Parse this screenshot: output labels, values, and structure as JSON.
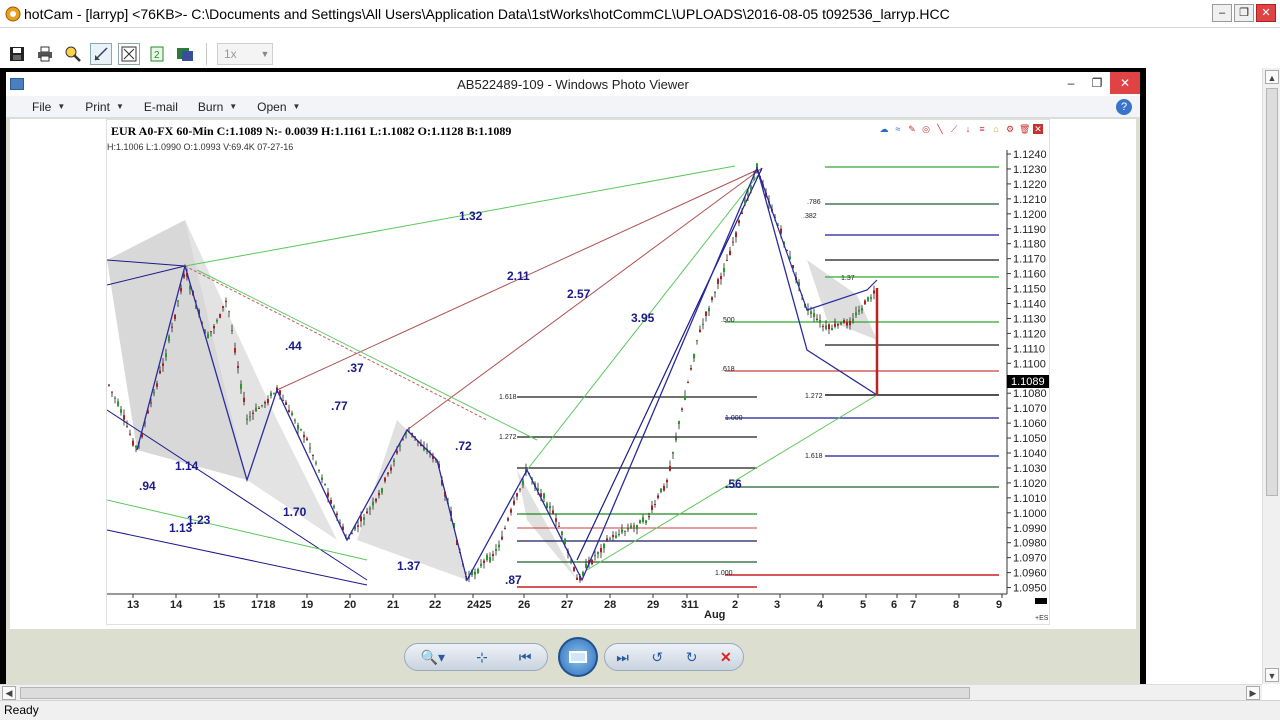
{
  "app": {
    "title": "hotCam - [larryp] <76KB>- C:\\Documents and Settings\\All Users\\Application Data\\1stWorks\\hotCommCL\\UPLOADS\\2016-08-05 t092536_larryp.HCC",
    "zoom_value": "1x"
  },
  "toolbar": {
    "icons": [
      "save-icon",
      "print-icon",
      "search-tools-icon",
      "draw-icon",
      "fit-icon",
      "refresh-icon",
      "export-icon"
    ]
  },
  "viewer": {
    "title": "AB522489-109 - Windows Photo Viewer",
    "menu": [
      {
        "label": "File",
        "caret": true
      },
      {
        "label": "Print",
        "caret": true
      },
      {
        "label": "E-mail",
        "caret": false
      },
      {
        "label": "Burn",
        "caret": true
      },
      {
        "label": "Open",
        "caret": true
      }
    ]
  },
  "chart": {
    "header": "EUR A0-FX 60-Min C:1.1089 N:- 0.0039 H:1.1161 L:1.1082 O:1.1128 B:1.1089",
    "subheader": "H:1.1006  L:1.0990  O:1.0993  V:69.4K  07-27-16",
    "current_price": "1.1089",
    "month_label": "Aug",
    "corner_label": "+ES"
  },
  "chart_data": {
    "type": "line",
    "y_ticks": [
      "1.1240",
      "1.1230",
      "1.1220",
      "1.1210",
      "1.1200",
      "1.1190",
      "1.1180",
      "1.1170",
      "1.1160",
      "1.1150",
      "1.1140",
      "1.1130",
      "1.1120",
      "1.1110",
      "1.1100",
      "1.1089",
      "1.1080",
      "1.1070",
      "1.1060",
      "1.1050",
      "1.1040",
      "1.1030",
      "1.1020",
      "1.1010",
      "1.1000",
      "1.0990",
      "1.0980",
      "1.0970",
      "1.0960",
      "1.0950"
    ],
    "x_ticks": [
      "13",
      "14",
      "15",
      "1718",
      "19",
      "20",
      "21",
      "22",
      "2425",
      "26",
      "27",
      "28",
      "29",
      "311",
      "2",
      "3",
      "4",
      "5",
      "6",
      "7",
      "8",
      "9"
    ],
    "ratio_labels": [
      "1.32",
      "2.11",
      "2.57",
      "3.95",
      ".44",
      ".37",
      ".77",
      ".72",
      "1.14",
      "1.70",
      "1.23",
      "1.13",
      "1.37",
      ".94",
      ".87",
      ".56"
    ],
    "small_labels": [
      "1.618",
      "1.272",
      "1.000",
      "1.37",
      "1.618",
      "1.272",
      "1.000",
      ".618",
      ".786",
      ".382",
      ".500"
    ],
    "ylim": [
      1.0945,
      1.1245
    ]
  },
  "controls": {
    "buttons": [
      "zoom-icon",
      "actual-size-icon",
      "previous-icon",
      "slideshow-icon",
      "next-icon",
      "rotate-left-icon",
      "rotate-right-icon",
      "delete-icon"
    ]
  },
  "status": {
    "text": "Ready"
  }
}
